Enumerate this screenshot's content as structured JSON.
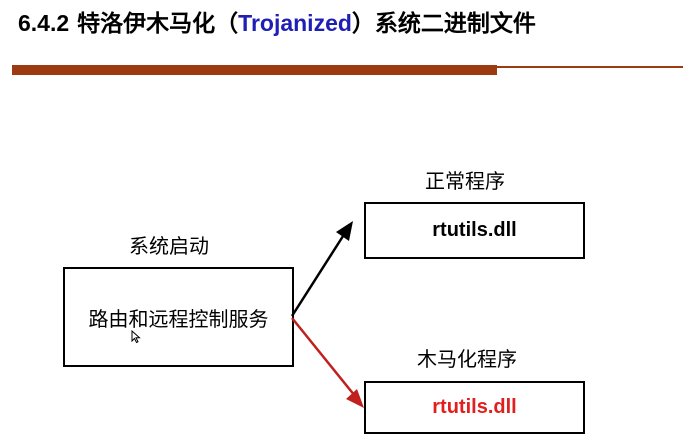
{
  "slide": {
    "title_number": "6.4.2",
    "title_prefix": "特洛伊木马化（",
    "title_english": "Trojanized",
    "title_suffix": "）系统二进制文件"
  },
  "diagram": {
    "source_caption": "系统启动",
    "source_box_text": "路由和远程控制服务",
    "normal_caption": "正常程序",
    "normal_box_text": "rtutils.dll",
    "trojan_caption": "木马化程序",
    "trojan_box_text": "rtutils.dll"
  },
  "colors": {
    "title_accent": "#1f1fb4",
    "rule": "#9c3a12",
    "trojan_red": "#e0201e",
    "trojan_arrow": "#c0201e",
    "normal_arrow": "#000000"
  }
}
